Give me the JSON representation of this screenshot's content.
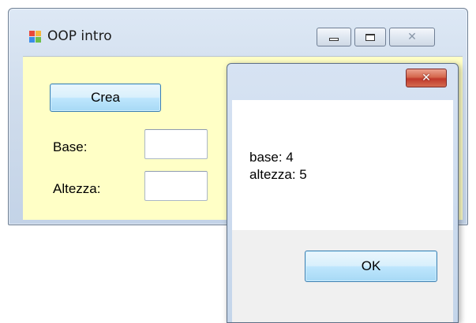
{
  "main_window": {
    "title": "OOP intro",
    "client_background": "#ffffc6"
  },
  "form": {
    "crea_button_label": "Crea",
    "base_label": "Base:",
    "base_value": "",
    "altezza_label": "Altezza:",
    "altezza_value": ""
  },
  "message_box": {
    "lines": [
      "base: 4",
      "altezza: 5"
    ],
    "ok_label": "OK"
  },
  "icons": {
    "app": "winforms-app-icon",
    "minimize": "minimize-icon",
    "maximize": "maximize-icon",
    "close": "close-icon"
  }
}
